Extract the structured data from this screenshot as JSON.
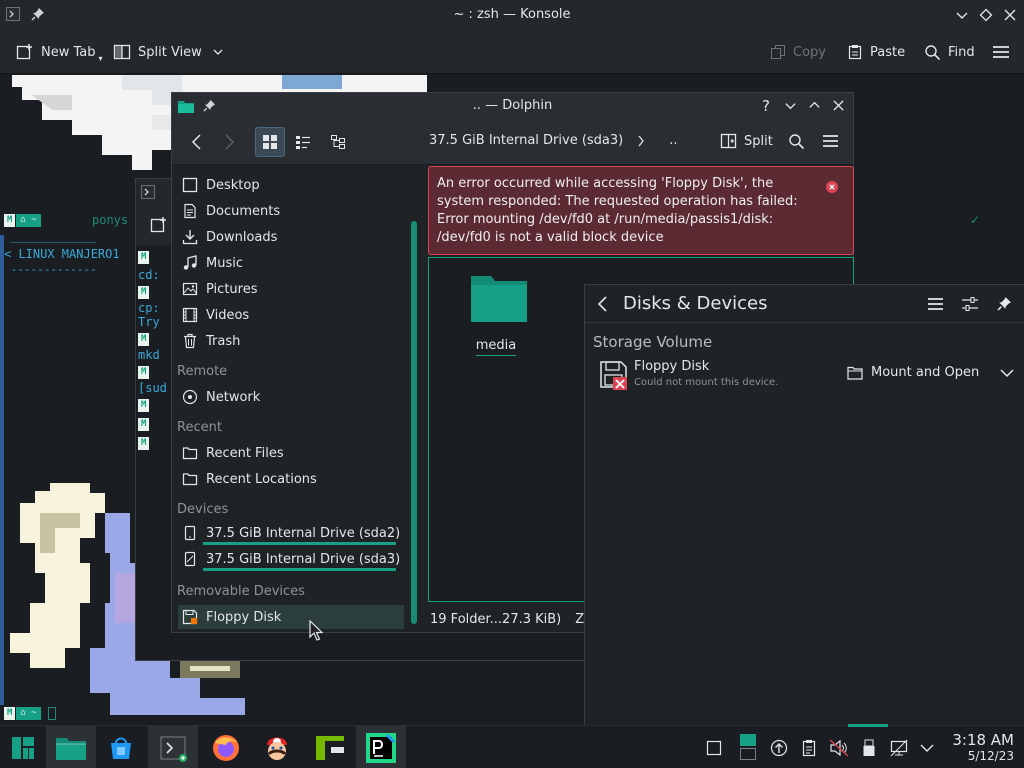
{
  "konsole": {
    "title": "~ : zsh — Konsole",
    "toolbar": {
      "new_tab": "New Tab",
      "split_view": "Split View",
      "copy": "Copy",
      "paste": "Paste",
      "find": "Find"
    },
    "term": {
      "prompt_user": "ponys",
      "banner": "< LINUX MANJERO1",
      "dashes_top": " _____________",
      "dashes_bottom": " -------------",
      "lines": [
        "cd:",
        "cp:",
        "Try",
        "mkd",
        "[sud"
      ]
    }
  },
  "dolphin": {
    "title": ".. — Dolphin",
    "breadcrumb_drive": "37.5 GiB Internal Drive (sda3)",
    "breadcrumb_up": "..",
    "split": "Split",
    "places": {
      "desktop": "Desktop",
      "documents": "Documents",
      "downloads": "Downloads",
      "music": "Music",
      "pictures": "Pictures",
      "videos": "Videos",
      "trash": "Trash",
      "remote_heading": "Remote",
      "network": "Network",
      "recent_heading": "Recent",
      "recent_files": "Recent Files",
      "recent_locations": "Recent Locations",
      "devices_heading": "Devices",
      "sda2": "37.5 GiB Internal Drive (sda2)",
      "sda3": "37.5 GiB Internal Drive (sda3)",
      "removable_heading": "Removable Devices",
      "floppy": "Floppy Disk"
    },
    "sda2_usage": 0.98,
    "sda3_usage": 0.98,
    "error_message": "An error occurred while accessing 'Floppy Disk', the system responded: The requested operation has failed: Error mounting /dev/fd0 at /run/media/passis1/disk: /dev/fd0 is not a valid block device",
    "folder_name": "media",
    "status_summary": "19 Folder...27.3 KiB)",
    "status_zoom": "Zoo"
  },
  "disks": {
    "title": "Disks & Devices",
    "section": "Storage Volume",
    "device_name": "Floppy Disk",
    "device_status": "Could not mount this device.",
    "action": "Mount and Open"
  },
  "taskbar": {
    "time": "3:18 AM",
    "date": "5/12/23"
  },
  "colors": {
    "accent": "#16a085",
    "error_bg": "#5c2a32",
    "error_border": "#da4453"
  }
}
